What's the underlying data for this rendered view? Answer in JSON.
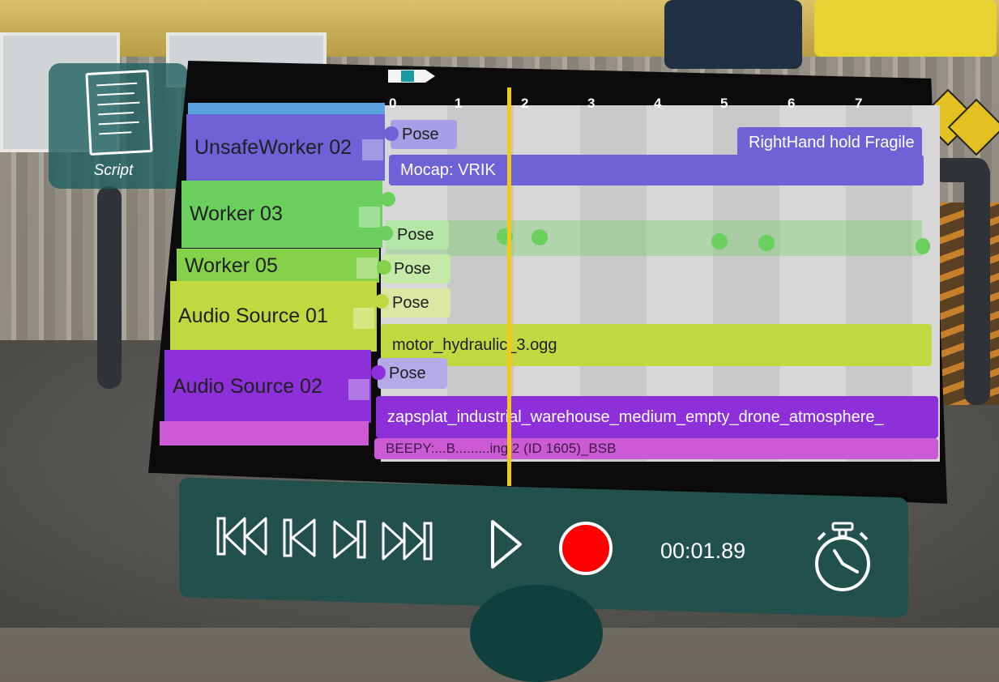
{
  "script_button": {
    "label": "Script"
  },
  "ruler": {
    "ticks": [
      "0",
      "1",
      "2",
      "3",
      "4",
      "5",
      "6",
      "7"
    ]
  },
  "tracks": [
    {
      "name": "UnsafeWorker 02",
      "color": "#6f61d6"
    },
    {
      "name": "Worker 03",
      "color": "#6acf5c"
    },
    {
      "name": "Worker 05",
      "color": "#84d24a"
    },
    {
      "name": "Audio Source 01",
      "color": "#c2d840"
    },
    {
      "name": "Audio Source 02",
      "color": "#8d30d9"
    }
  ],
  "clips": {
    "pose_label": "Pose",
    "righthand": "RightHand hold Fragile",
    "mocap": "Mocap: VRIK",
    "audio1": "motor_hydraulic_3.ogg",
    "audio2": "zapsplat_industrial_warehouse_medium_empty_drone_atmosphere_",
    "audio3_partial": "BEEPY:...B.........ing 2 (ID 1605)_BSB"
  },
  "transport": {
    "time": "00:01.89",
    "record_color": "#ff0000"
  },
  "icons": [
    "script-icon",
    "skip-to-start-icon",
    "step-back-icon",
    "step-forward-icon",
    "skip-to-end-icon",
    "play-icon",
    "record-icon",
    "stopwatch-icon"
  ]
}
